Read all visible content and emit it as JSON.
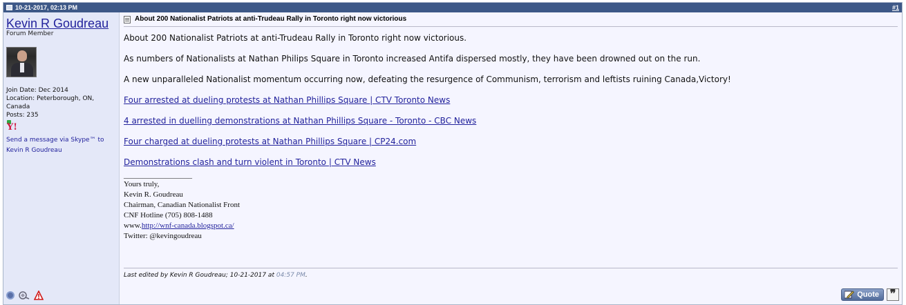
{
  "header": {
    "date": "10-21-2017, 02:13 PM",
    "post_number": "#1"
  },
  "user": {
    "name": "Kevin R Goudreau",
    "title": "Forum Member",
    "join_date": "Join Date: Dec 2014",
    "location": "Location: Peterborough, ON, Canada",
    "posts": "Posts: 235",
    "skype_link": "Send a message via Skype™ to Kevin R Goudreau"
  },
  "post": {
    "title": "About 200 Nationalist Patriots at anti-Trudeau Rally in Toronto right now victorious",
    "paragraphs": [
      "About 200 Nationalist Patriots at anti-Trudeau Rally in Toronto right now victorious.",
      "As numbers of Nationalists at Nathan Philips Square in Toronto increased Antifa dispersed mostly, they have been drowned out on the run.",
      "A new unparalleled Nationalist momentum occurring now, defeating the resurgence of Communism, terrorism and leftists ruining Canada,Victory!"
    ],
    "links": [
      "Four arrested at dueling protests at Nathan Phillips Square | CTV Toronto News",
      "4 arrested in duelling demonstrations at Nathan Phillips Square - Toronto - CBC News",
      "Four charged at dueling protests at Nathan Phillips Square | CP24.com",
      "Demonstrations clash and turn violent in Toronto | CTV News"
    ]
  },
  "signature": {
    "separator": "__________________",
    "line1": "Yours truly,",
    "line2": "Kevin R. Goudreau",
    "line3": "Chairman, Canadian Nationalist Front",
    "line4": "CNF Hotline (705) 808-1488",
    "www_prefix": "www.",
    "www_link": "http://wnf-canada.blogspot.ca/",
    "line6": "Twitter: @kevingoudreau"
  },
  "edited": {
    "prefix": "Last edited by Kevin R Goudreau; 10-21-2017 at",
    "time": "04:57 PM",
    "suffix": "."
  },
  "actions": {
    "quote_label": "Quote",
    "multiquote_glyph": "❞"
  },
  "icons": {
    "header": "post-icon",
    "online_status": "offline-status-icon",
    "report": "report-post-icon",
    "warn": "warning-icon"
  }
}
